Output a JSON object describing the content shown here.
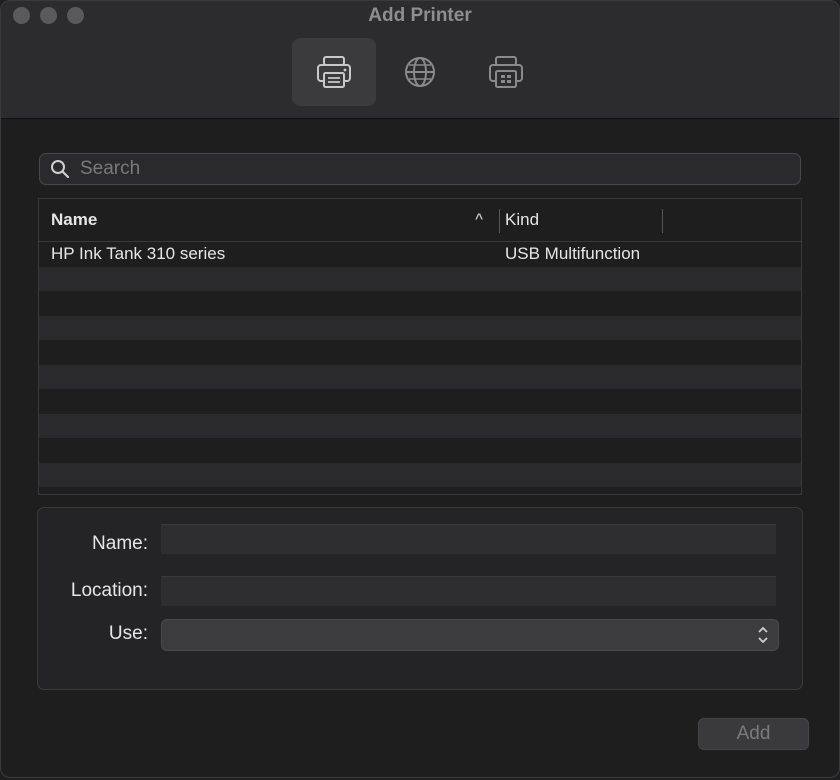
{
  "window": {
    "title": "Add Printer"
  },
  "toolbar": {
    "items": [
      {
        "icon": "default-printer-icon",
        "selected": true
      },
      {
        "icon": "ip-globe-icon",
        "selected": false
      },
      {
        "icon": "windows-printer-icon",
        "selected": false
      }
    ]
  },
  "search": {
    "placeholder": "Search",
    "value": ""
  },
  "table": {
    "columns": [
      "Name",
      "Kind"
    ],
    "rows": [
      {
        "name": "HP Ink Tank 310 series",
        "kind": "USB Multifunction"
      }
    ]
  },
  "form": {
    "name_label": "Name:",
    "location_label": "Location:",
    "use_label": "Use:",
    "name_value": "",
    "location_value": "",
    "use_value": ""
  },
  "buttons": {
    "add_label": "Add"
  }
}
